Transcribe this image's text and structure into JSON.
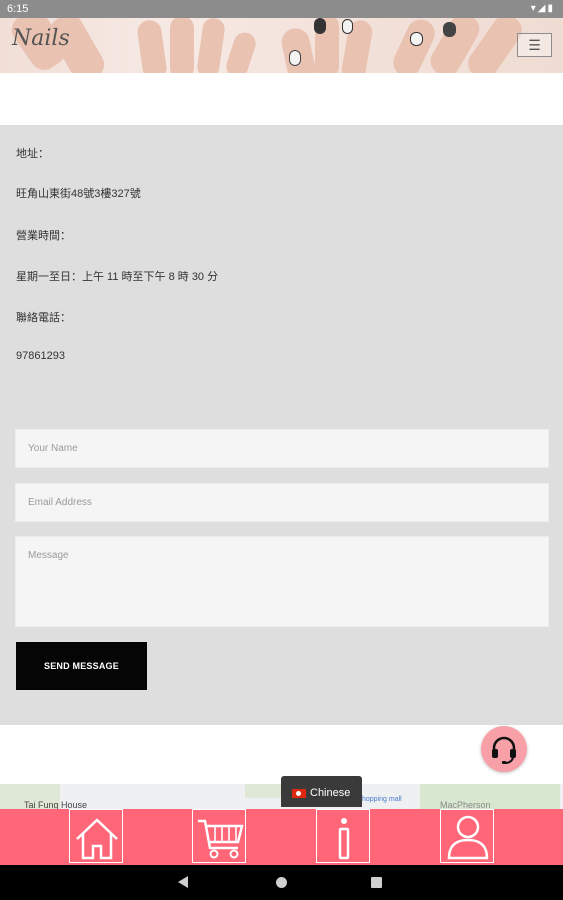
{
  "status_bar": {
    "time": "6:15",
    "icons": [
      "wifi-icon",
      "signal-icon",
      "battery-icon"
    ]
  },
  "header": {
    "logo_text": "Nails",
    "menu_icon": "hamburger-menu-icon"
  },
  "contact_info": {
    "address_label": "地址：",
    "address_value": "旺角山東街48號3樓327號",
    "hours_label": "營業時間：",
    "hours_value": "星期一至日：上午 11 時至下午 8 時 30 分",
    "phone_label": "聯絡電話：",
    "phone_value": "97861293"
  },
  "contact_form": {
    "name_placeholder": "Your Name",
    "email_placeholder": "Email Address",
    "message_placeholder": "Message",
    "send_label": "SEND MESSAGE"
  },
  "map": {
    "labels": [
      "Tai Fung House",
      "MacPherson",
      "hopping mall"
    ]
  },
  "language": {
    "label": "Chinese",
    "flag": "hong-kong-flag-icon"
  },
  "bottom_tabs": [
    {
      "icon": "home-icon"
    },
    {
      "icon": "cart-icon"
    },
    {
      "icon": "info-icon"
    },
    {
      "icon": "user-icon"
    }
  ],
  "colors": {
    "accent": "#ff6678",
    "panel": "#dedede",
    "send_button": "#050505",
    "support_button": "#f7a0a8"
  }
}
